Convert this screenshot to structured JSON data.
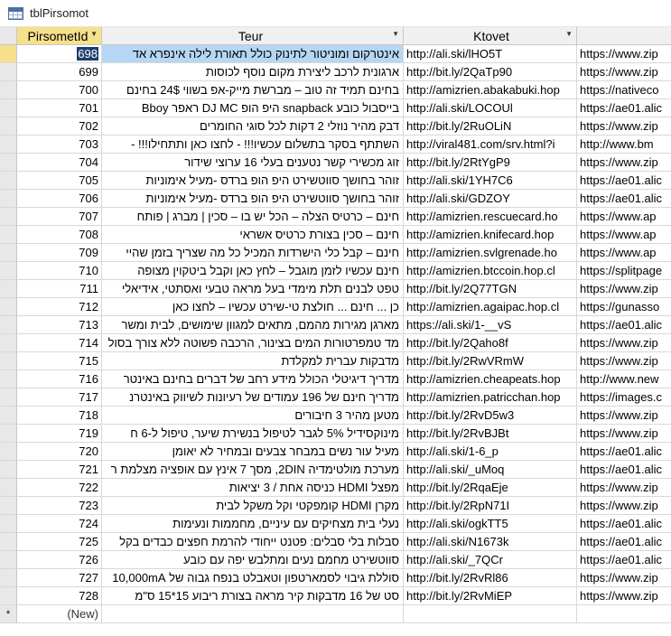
{
  "window": {
    "title": "tblPirsomot",
    "icon": "table-icon"
  },
  "columns": {
    "id": "PirsometId",
    "teur": "Teur",
    "ktovet": "Ktovet"
  },
  "rows": [
    {
      "id": "698",
      "teur": "אינטרקום ומוניטור לתינוק כולל תאורת לילה אינפרא אד",
      "ktovet": "http://ali.ski/lHO5T",
      "extra": "https://www.zip"
    },
    {
      "id": "699",
      "teur": "ארגונית לרכב ליצירת מקום נוסף לכוסות",
      "ktovet": "http://bit.ly/2QaTp90",
      "extra": "https://www.zip"
    },
    {
      "id": "700",
      "teur": "בחינם תמיד זה טוב – מברשת מייק-אפ בשווי 24$ בחינם",
      "ktovet": "http://amizrien.abakabuki.hop",
      "extra": "https://nativeco"
    },
    {
      "id": "701",
      "teur": "בייסבול כובע snapback היפ הופ DJ MC ראפר Bboy",
      "ktovet": "http://ali.ski/LOCOUl",
      "extra": "https://ae01.alic"
    },
    {
      "id": "702",
      "teur": "דבק מהיר נוזלי 2 דקות לכל סוגי החומרים",
      "ktovet": "http://bit.ly/2RuOLiN",
      "extra": "https://www.zip"
    },
    {
      "id": "703",
      "teur": "השתתף בסקר בתשלום עכשיו!!! - לחצו כאן ותתחילו!!! -",
      "ktovet": "http://viral481.com/srv.html?i",
      "extra": "http://www.bm"
    },
    {
      "id": "704",
      "teur": "זוג מכשירי קשר נטענים בעלי 16 ערוצי שידור",
      "ktovet": "http://bit.ly/2RtYgP9",
      "extra": "https://www.zip"
    },
    {
      "id": "705",
      "teur": "זוהר בחושך סווטשירט היפ הופ ברדס -מעיל אימוניות",
      "ktovet": "http://ali.ski/1YH7C6",
      "extra": "https://ae01.alic"
    },
    {
      "id": "706",
      "teur": "זוהר בחושך סווטשירט היפ הופ ברדס -מעיל אימוניות",
      "ktovet": "http://ali.ski/GDZOY",
      "extra": "https://ae01.alic"
    },
    {
      "id": "707",
      "teur": "חינם – כרטיס הצלה – הכל יש בו – סכין | מברג | פותח",
      "ktovet": "http://amizrien.rescuecard.ho",
      "extra": "https://www.ap"
    },
    {
      "id": "708",
      "teur": "חינם – סכין בצורת כרטיס אשראי",
      "ktovet": "http://amizrien.knifecard.hop",
      "extra": "https://www.ap"
    },
    {
      "id": "709",
      "teur": "חינם – קבל כלי הישרדות המכיל כל מה שצריך בזמן שהיי",
      "ktovet": "http://amizrien.svlgrenade.ho",
      "extra": "https://www.ap"
    },
    {
      "id": "710",
      "teur": "חינם עכשיו לזמן מוגבל – לחץ כאן וקבל ביטקוין מצופה",
      "ktovet": "http://amizrien.btccoin.hop.cl",
      "extra": "https://splitpage"
    },
    {
      "id": "711",
      "teur": "טפט לבנים תלת מימדי בעל מראה טבעי ואסתטי, אידיאלי",
      "ktovet": "http://bit.ly/2Q77TGN",
      "extra": "https://www.zip"
    },
    {
      "id": "712",
      "teur": "כן ... חינם ... חולצת טי-שירט עכשיו – לחצו כאן",
      "ktovet": "http://amizrien.agaipac.hop.cl",
      "extra": "https://gunasso"
    },
    {
      "id": "713",
      "teur": "מארגן מגירות מהמם, מתאים למגוון שימושים, לבית ומשר",
      "ktovet": "https://ali.ski/1-__vS",
      "extra": "https://ae01.alic"
    },
    {
      "id": "714",
      "teur": "מד טמפרטורות המים בצינור, הרכבה פשוטה ללא צורך בסול",
      "ktovet": "http://bit.ly/2Qaho8f",
      "extra": "https://www.zip"
    },
    {
      "id": "715",
      "teur": "מדבקות עברית למקלדת",
      "ktovet": "http://bit.ly/2RwVRmW",
      "extra": "https://www.zip"
    },
    {
      "id": "716",
      "teur": "מדריך דיגיטלי הכולל מידע רחב של דברים בחינם באינטר",
      "ktovet": "http://amizrien.cheapeats.hop",
      "extra": "http://www.new"
    },
    {
      "id": "717",
      "teur": "מדריך חינם של 196 עמודים של רעיונות לשיווק באינטרנ",
      "ktovet": "http://amizrien.patricchan.hop",
      "extra": "https://images.c"
    },
    {
      "id": "718",
      "teur": "מטען מהיר 3 חיבורים",
      "ktovet": "http://bit.ly/2RvD5w3",
      "extra": "https://www.zip"
    },
    {
      "id": "719",
      "teur": "מינוקסידיל 5% לגבר לטיפול בנשירת שיער, טיפול ל-6 ח",
      "ktovet": "http://bit.ly/2RvBJBt",
      "extra": "https://www.zip"
    },
    {
      "id": "720",
      "teur": "מעיל עור נשים במבחר צבעים ובמחיר לא יאומן",
      "ktovet": "http://ali.ski/1-6_p",
      "extra": "https://ae01.alic"
    },
    {
      "id": "721",
      "teur": "מערכת מולטימדיה 2DIN, מסך 7 אינץ עם אופציה מצלמת ר",
      "ktovet": "http://ali.ski/_uMoq",
      "extra": "https://ae01.alic"
    },
    {
      "id": "722",
      "teur": "מפצל HDMI כניסה אחת / 3 יציאות",
      "ktovet": "http://bit.ly/2RqaEje",
      "extra": "https://www.zip"
    },
    {
      "id": "723",
      "teur": "מקרן HDMI קומפקטי וקל משקל לבית",
      "ktovet": "http://bit.ly/2RpN71I",
      "extra": "https://www.zip"
    },
    {
      "id": "724",
      "teur": "נעלי בית מצחיקים עם עיניים, מחממות ונעימות",
      "ktovet": "http://ali.ski/ogkTT5",
      "extra": "https://ae01.alic"
    },
    {
      "id": "725",
      "teur": "סבלות בלי סבלים: פטנט ייחודי להרמת חפצים כבדים בקל",
      "ktovet": "http://ali.ski/N1673k",
      "extra": "https://ae01.alic"
    },
    {
      "id": "726",
      "teur": "סווטשירט מחמם נעים ומתלבש יפה עם כובע",
      "ktovet": "http://ali.ski/_7QCr",
      "extra": "https://ae01.alic"
    },
    {
      "id": "727",
      "teur": "סוללת גיבוי לסמארטפון וטאבלט בנפח גבוה של 10,000mA",
      "ktovet": "http://bit.ly/2RvRl86",
      "extra": "https://www.zip"
    },
    {
      "id": "728",
      "teur": "סט של 16 מדבקות קיר מראה בצורת ריבוע 15*15 ס\"מ",
      "ktovet": "http://bit.ly/2RvMiEP",
      "extra": "https://www.zip"
    }
  ],
  "new_row": {
    "selector": "*",
    "label": "(New)"
  }
}
